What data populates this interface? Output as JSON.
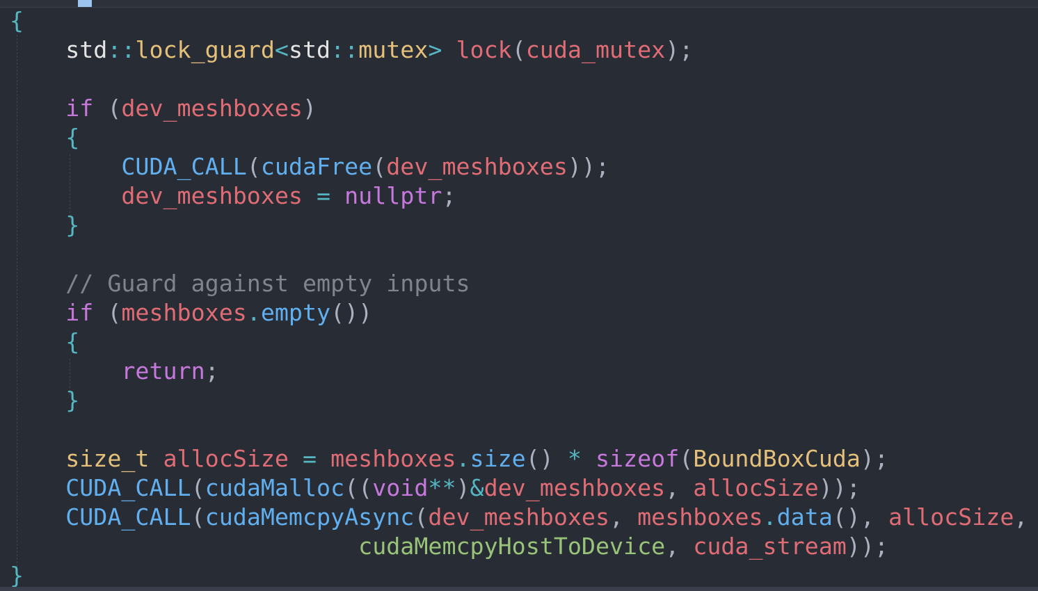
{
  "editor": {
    "language": "cpp",
    "theme_colors": {
      "background": "#282c34",
      "keyword": "#c678dd",
      "function": "#61afef",
      "variable": "#e06c75",
      "type": "#e5c07b",
      "operator": "#56b6c2",
      "comment": "#7f848e",
      "constant": "#98c379"
    },
    "lines": [
      {
        "tokens": [
          {
            "t": "{",
            "c": "brace-outer"
          }
        ]
      },
      {
        "tokens": [
          {
            "t": "    "
          },
          {
            "t": "std",
            "c": "ns"
          },
          {
            "t": "::",
            "c": "op"
          },
          {
            "t": "lock_guard",
            "c": "type"
          },
          {
            "t": "<",
            "c": "op"
          },
          {
            "t": "std",
            "c": "ns"
          },
          {
            "t": "::",
            "c": "op"
          },
          {
            "t": "mutex",
            "c": "type"
          },
          {
            "t": ">",
            "c": "op"
          },
          {
            "t": " "
          },
          {
            "t": "lock",
            "c": "var"
          },
          {
            "t": "(",
            "c": "punct"
          },
          {
            "t": "cuda_mutex",
            "c": "var"
          },
          {
            "t": ");",
            "c": "punct"
          }
        ]
      },
      {
        "tokens": []
      },
      {
        "tokens": [
          {
            "t": "    "
          },
          {
            "t": "if",
            "c": "kw"
          },
          {
            "t": " (",
            "c": "punct"
          },
          {
            "t": "dev_meshboxes",
            "c": "var"
          },
          {
            "t": ")",
            "c": "punct"
          }
        ]
      },
      {
        "tokens": [
          {
            "t": "    "
          },
          {
            "t": "{",
            "c": "brace"
          }
        ]
      },
      {
        "tokens": [
          {
            "t": "        "
          },
          {
            "t": "CUDA_CALL",
            "c": "fn"
          },
          {
            "t": "(",
            "c": "punct"
          },
          {
            "t": "cudaFree",
            "c": "fn"
          },
          {
            "t": "(",
            "c": "punct"
          },
          {
            "t": "dev_meshboxes",
            "c": "var"
          },
          {
            "t": "));",
            "c": "punct"
          }
        ]
      },
      {
        "tokens": [
          {
            "t": "        "
          },
          {
            "t": "dev_meshboxes",
            "c": "var"
          },
          {
            "t": " "
          },
          {
            "t": "=",
            "c": "op"
          },
          {
            "t": " "
          },
          {
            "t": "nullptr",
            "c": "kw"
          },
          {
            "t": ";",
            "c": "punct"
          }
        ]
      },
      {
        "tokens": [
          {
            "t": "    "
          },
          {
            "t": "}",
            "c": "brace"
          }
        ]
      },
      {
        "tokens": []
      },
      {
        "tokens": [
          {
            "t": "    "
          },
          {
            "t": "// Guard against empty inputs",
            "c": "comment"
          }
        ]
      },
      {
        "tokens": [
          {
            "t": "    "
          },
          {
            "t": "if",
            "c": "kw"
          },
          {
            "t": " (",
            "c": "punct"
          },
          {
            "t": "meshboxes",
            "c": "var"
          },
          {
            "t": ".",
            "c": "op"
          },
          {
            "t": "empty",
            "c": "fn"
          },
          {
            "t": "())",
            "c": "punct"
          }
        ]
      },
      {
        "tokens": [
          {
            "t": "    "
          },
          {
            "t": "{",
            "c": "brace"
          }
        ]
      },
      {
        "tokens": [
          {
            "t": "        "
          },
          {
            "t": "return",
            "c": "kw"
          },
          {
            "t": ";",
            "c": "punct"
          }
        ]
      },
      {
        "tokens": [
          {
            "t": "    "
          },
          {
            "t": "}",
            "c": "brace"
          }
        ]
      },
      {
        "tokens": []
      },
      {
        "tokens": [
          {
            "t": "    "
          },
          {
            "t": "size_t",
            "c": "type"
          },
          {
            "t": " "
          },
          {
            "t": "allocSize",
            "c": "var"
          },
          {
            "t": " "
          },
          {
            "t": "=",
            "c": "op"
          },
          {
            "t": " "
          },
          {
            "t": "meshboxes",
            "c": "var"
          },
          {
            "t": ".",
            "c": "op"
          },
          {
            "t": "size",
            "c": "fn"
          },
          {
            "t": "()",
            "c": "punct"
          },
          {
            "t": " "
          },
          {
            "t": "*",
            "c": "op"
          },
          {
            "t": " "
          },
          {
            "t": "sizeof",
            "c": "kw"
          },
          {
            "t": "(",
            "c": "punct"
          },
          {
            "t": "BoundBoxCuda",
            "c": "type"
          },
          {
            "t": ");",
            "c": "punct"
          }
        ]
      },
      {
        "tokens": [
          {
            "t": "    "
          },
          {
            "t": "CUDA_CALL",
            "c": "fn"
          },
          {
            "t": "(",
            "c": "punct"
          },
          {
            "t": "cudaMalloc",
            "c": "fn"
          },
          {
            "t": "((",
            "c": "punct"
          },
          {
            "t": "void",
            "c": "kw"
          },
          {
            "t": "**",
            "c": "op"
          },
          {
            "t": ")",
            "c": "punct"
          },
          {
            "t": "&",
            "c": "op"
          },
          {
            "t": "dev_meshboxes",
            "c": "var"
          },
          {
            "t": ",",
            "c": "punct"
          },
          {
            "t": " "
          },
          {
            "t": "allocSize",
            "c": "var"
          },
          {
            "t": "));",
            "c": "punct"
          }
        ]
      },
      {
        "tokens": [
          {
            "t": "    "
          },
          {
            "t": "CUDA_CALL",
            "c": "fn"
          },
          {
            "t": "(",
            "c": "punct"
          },
          {
            "t": "cudaMemcpyAsync",
            "c": "fn"
          },
          {
            "t": "(",
            "c": "punct"
          },
          {
            "t": "dev_meshboxes",
            "c": "var"
          },
          {
            "t": ",",
            "c": "punct"
          },
          {
            "t": " "
          },
          {
            "t": "meshboxes",
            "c": "var"
          },
          {
            "t": ".",
            "c": "op"
          },
          {
            "t": "data",
            "c": "fn"
          },
          {
            "t": "(),",
            "c": "punct"
          },
          {
            "t": " "
          },
          {
            "t": "allocSize",
            "c": "var"
          },
          {
            "t": ",",
            "c": "punct"
          }
        ]
      },
      {
        "tokens": [
          {
            "t": "                         "
          },
          {
            "t": "cudaMemcpyHostToDevice",
            "c": "const"
          },
          {
            "t": ",",
            "c": "punct"
          },
          {
            "t": " "
          },
          {
            "t": "cuda_stream",
            "c": "var"
          },
          {
            "t": "));",
            "c": "punct"
          }
        ]
      },
      {
        "tokens": [
          {
            "t": "}",
            "c": "brace-outer"
          }
        ]
      }
    ]
  }
}
